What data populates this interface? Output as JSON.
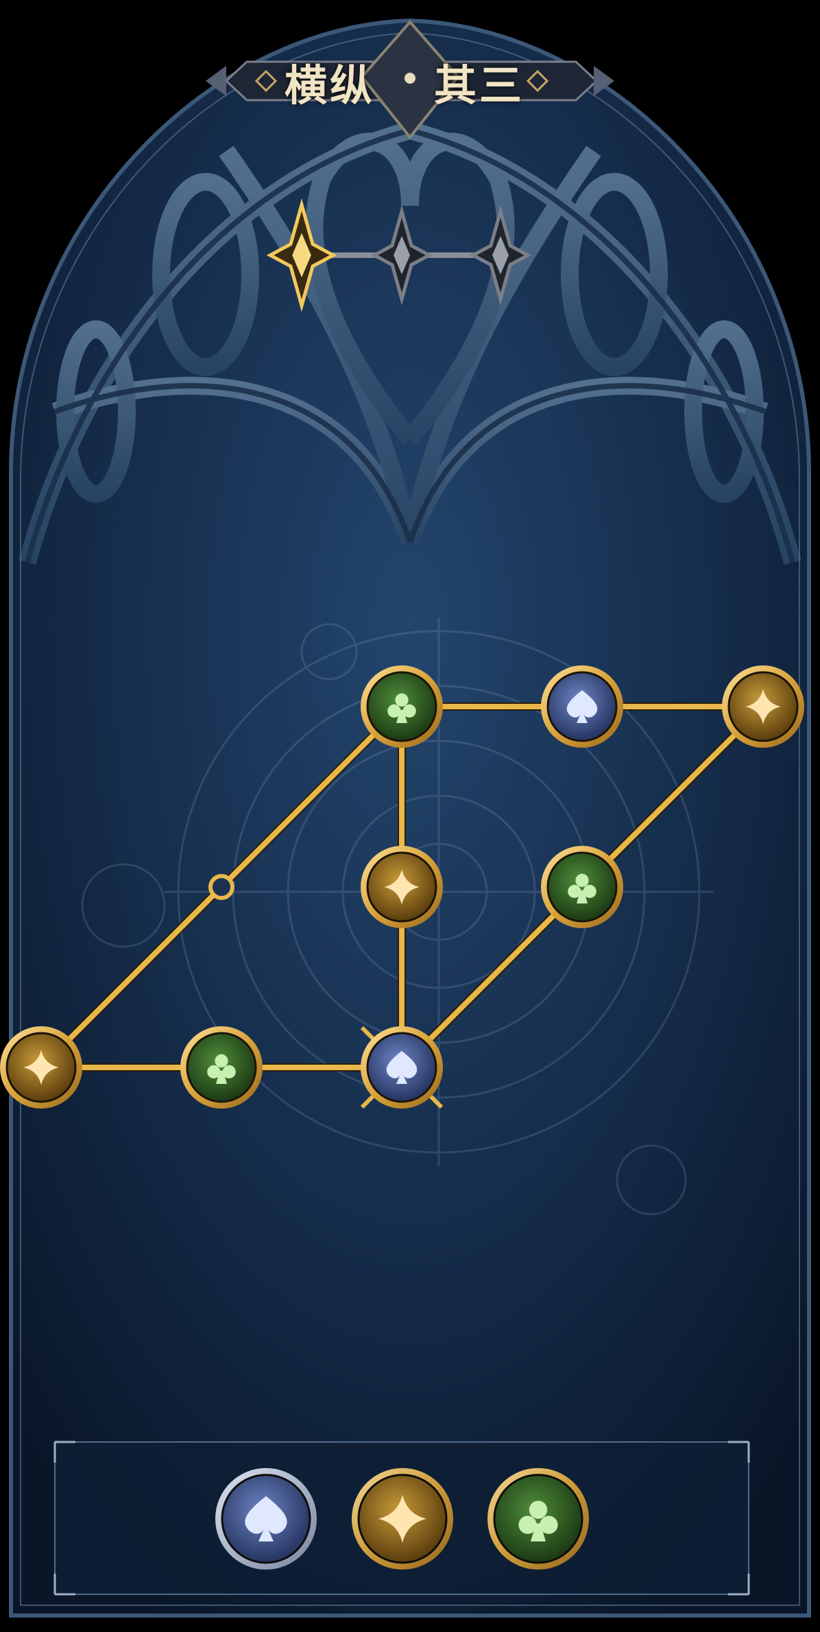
{
  "title": {
    "left": "横纵",
    "right": "其三"
  },
  "stage": {
    "progress_current": 1,
    "progress_total": 3,
    "stars": [
      {
        "state": "active"
      },
      {
        "state": "locked"
      },
      {
        "state": "locked"
      }
    ]
  },
  "suits": {
    "spade": {
      "icon": "spade-icon",
      "color": "#3a4f86"
    },
    "diamond": {
      "icon": "diamond-icon",
      "color": "#8a6418"
    },
    "club": {
      "icon": "club-icon",
      "color": "#2f5f23"
    }
  },
  "board": {
    "nodes": [
      {
        "id": "n1",
        "suit": "club"
      },
      {
        "id": "n2",
        "suit": "spade"
      },
      {
        "id": "n3",
        "suit": "diamond"
      },
      {
        "id": "n4",
        "suit": "diamond"
      },
      {
        "id": "n5",
        "suit": "club"
      },
      {
        "id": "n6",
        "suit": "diamond"
      },
      {
        "id": "n7",
        "suit": "club"
      },
      {
        "id": "n8",
        "suit": "spade",
        "selected": true
      },
      {
        "id": "n9",
        "suit": "empty"
      }
    ]
  },
  "tray": {
    "tokens": [
      {
        "suit": "spade"
      },
      {
        "suit": "diamond"
      },
      {
        "suit": "club"
      }
    ]
  },
  "colors": {
    "gold": "#e8b84a",
    "panel_bg": "#17304f",
    "frame": "#4e6c8a"
  }
}
